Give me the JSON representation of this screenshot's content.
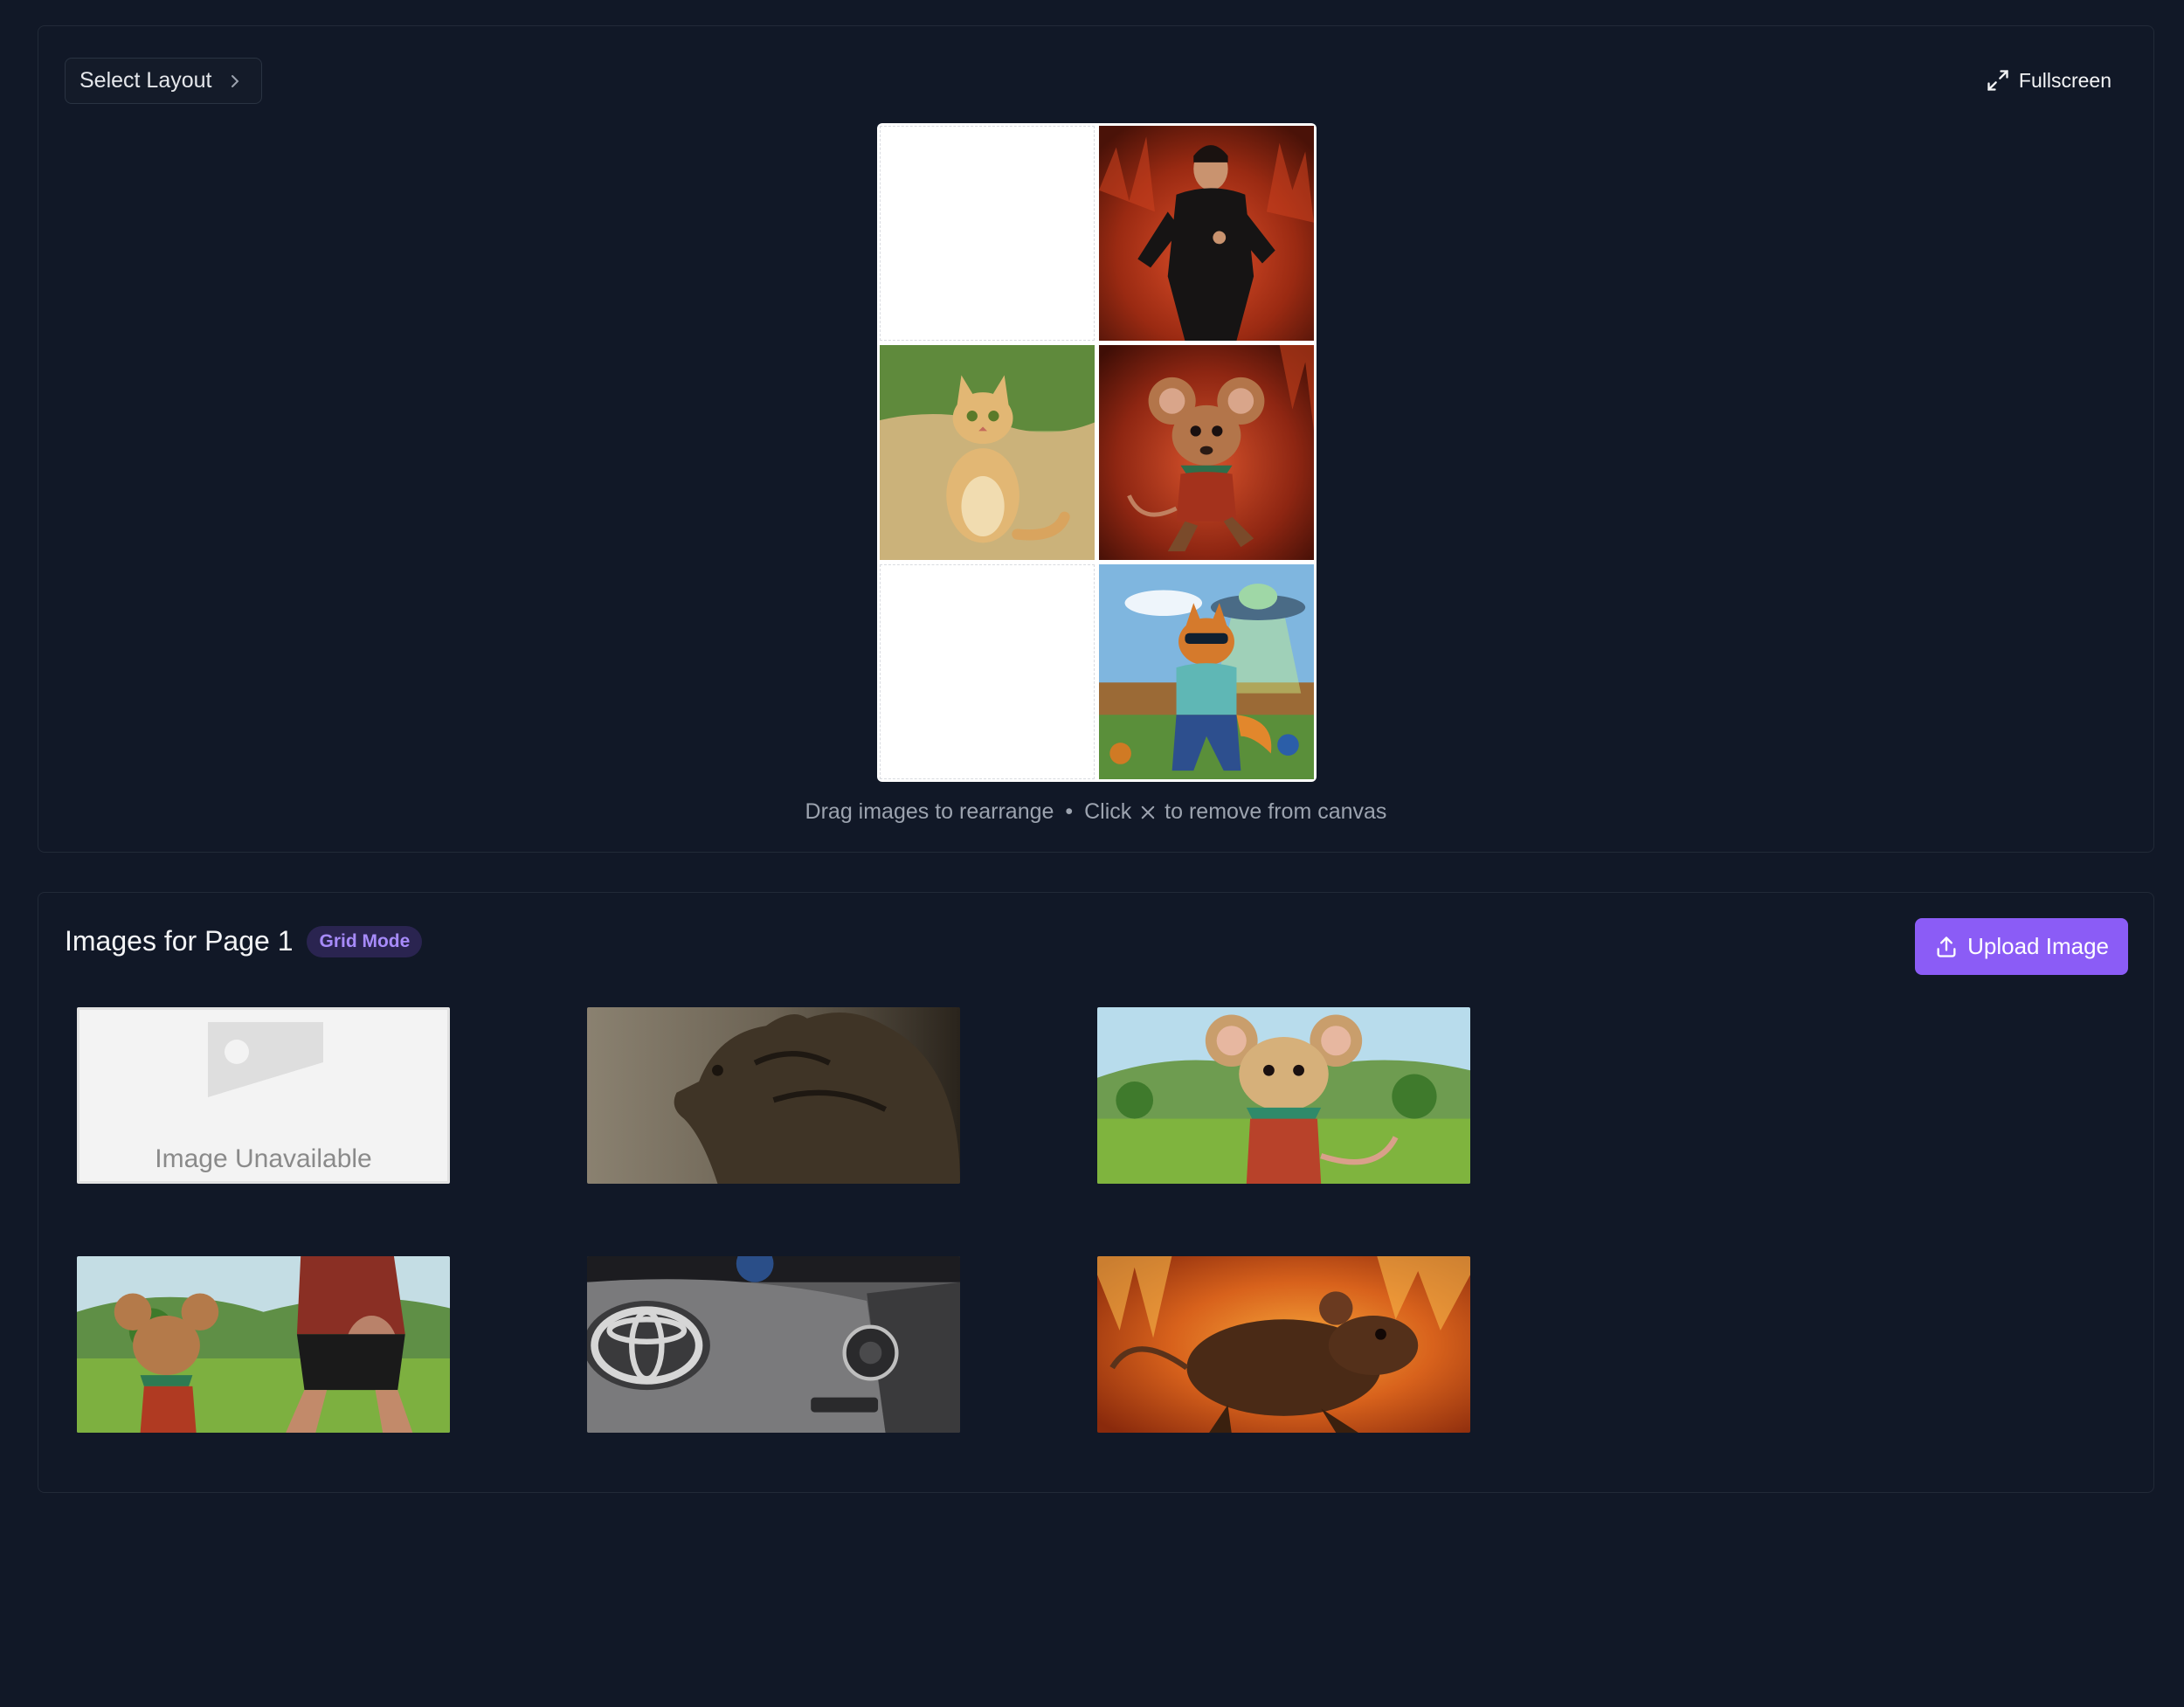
{
  "editor": {
    "select_layout_label": "Select Layout",
    "fullscreen_label": "Fullscreen",
    "hint_part1": "Drag images to rearrange",
    "hint_separator": "•",
    "hint_part2": "Click",
    "hint_part3": "to remove from canvas",
    "canvas_cells": [
      {
        "content": "empty"
      },
      {
        "content": "man-in-fire"
      },
      {
        "content": "cartoon-cat"
      },
      {
        "content": "mouse-in-fire"
      },
      {
        "content": "empty"
      },
      {
        "content": "fox-with-ufo"
      }
    ]
  },
  "images_panel": {
    "title": "Images for Page 1",
    "mode_badge": "Grid Mode",
    "upload_label": "Upload Image",
    "thumbnails": [
      {
        "kind": "unavailable",
        "label": "Image Unavailable"
      },
      {
        "kind": "cat-photo"
      },
      {
        "kind": "mouse-meadow"
      },
      {
        "kind": "mouse-and-runner"
      },
      {
        "kind": "toyota-steering-wheel"
      },
      {
        "kind": "rat-in-fire"
      }
    ]
  },
  "colors": {
    "background": "#111827",
    "accent": "#8b5cf6",
    "badge_text": "#a78bfa"
  }
}
